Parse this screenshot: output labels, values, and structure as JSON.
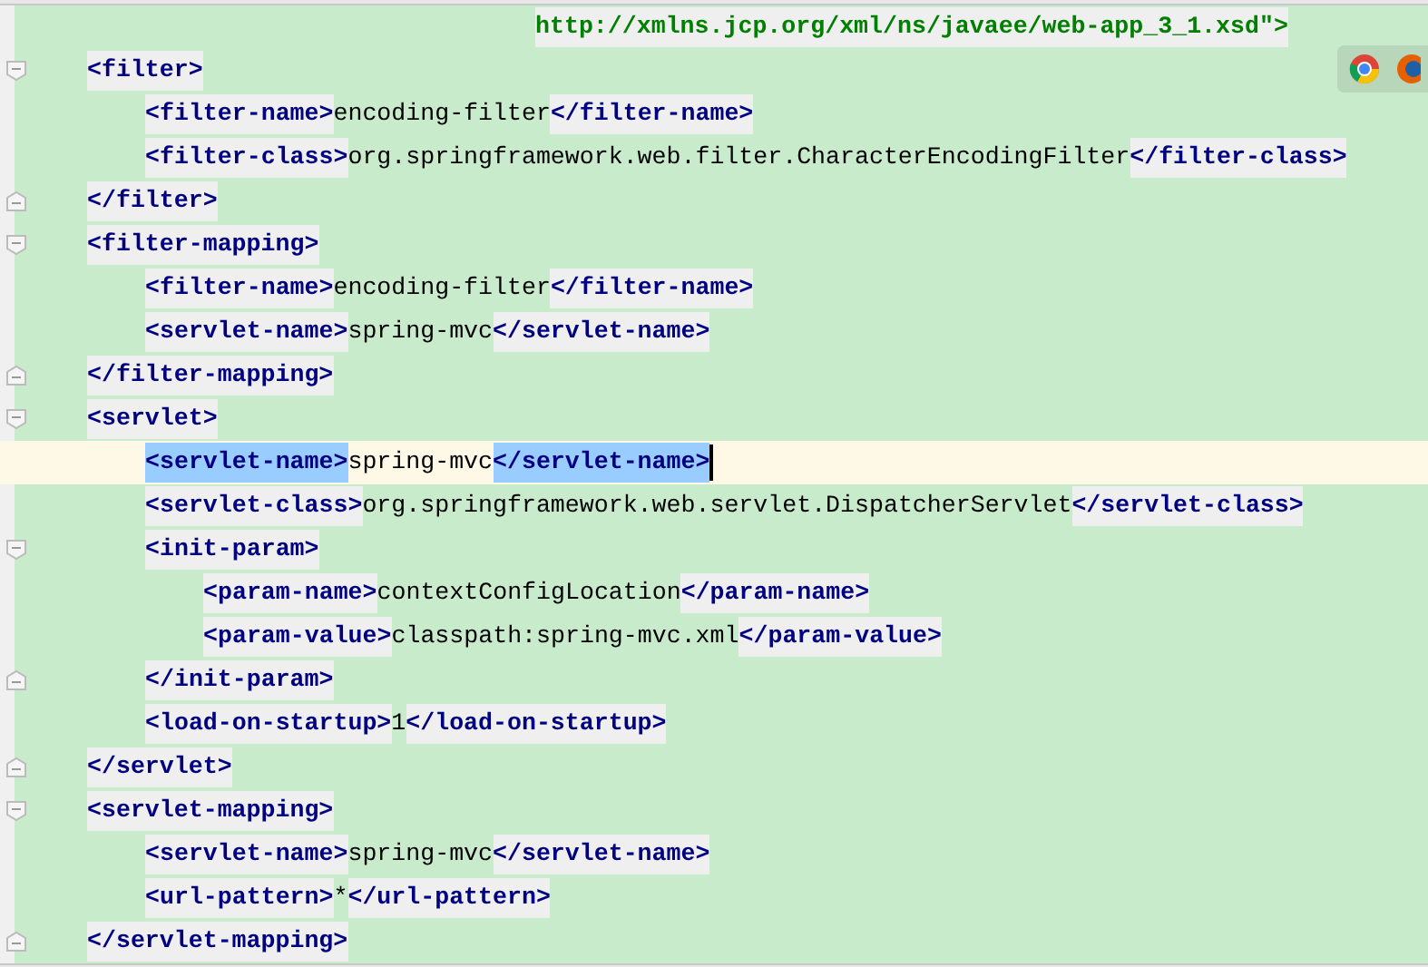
{
  "editor": {
    "lines": [
      {
        "kind": "continuation",
        "current": false,
        "tokens": [
          {
            "kind": "url",
            "text": "http://xmlns.jcp.org/xml/ns/javaee/web-app_3_1.xsd\">"
          }
        ]
      },
      {
        "kind": "open_tag",
        "current": false,
        "tokens": [
          {
            "kind": "tag",
            "text": "<filter>"
          }
        ],
        "children": [
          {
            "kind": "element",
            "current": false,
            "tokens": [
              {
                "kind": "tag",
                "text": "<filter-name>"
              },
              {
                "kind": "text",
                "text": "encoding-filter"
              },
              {
                "kind": "tag",
                "text": "</filter-name>"
              }
            ]
          },
          {
            "kind": "element",
            "current": false,
            "tokens": [
              {
                "kind": "tag",
                "text": "<filter-class>"
              },
              {
                "kind": "text",
                "text": "org.springframework.web.filter.CharacterEncodingFilter"
              },
              {
                "kind": "tag",
                "text": "</filter-class>"
              }
            ]
          }
        ]
      },
      {
        "kind": "close_tag",
        "current": false,
        "tokens": [
          {
            "kind": "tag",
            "text": "</filter>"
          }
        ]
      },
      {
        "kind": "open_tag",
        "current": false,
        "tokens": [
          {
            "kind": "tag",
            "text": "<filter-mapping>"
          }
        ],
        "children": [
          {
            "kind": "element",
            "current": false,
            "tokens": [
              {
                "kind": "tag",
                "text": "<filter-name>"
              },
              {
                "kind": "text",
                "text": "encoding-filter"
              },
              {
                "kind": "tag",
                "text": "</filter-name>"
              }
            ]
          },
          {
            "kind": "element",
            "current": false,
            "tokens": [
              {
                "kind": "tag",
                "text": "<servlet-name>"
              },
              {
                "kind": "text",
                "text": "spring-mvc"
              },
              {
                "kind": "tag",
                "text": "</servlet-name>"
              }
            ]
          }
        ]
      },
      {
        "kind": "close_tag",
        "current": false,
        "tokens": [
          {
            "kind": "tag",
            "text": "</filter-mapping>"
          }
        ]
      },
      {
        "kind": "open_tag",
        "current": false,
        "tokens": [
          {
            "kind": "tag",
            "text": "<servlet>"
          }
        ],
        "children": [
          {
            "kind": "element",
            "current": true,
            "tokens": [
              {
                "kind": "tag",
                "text": "<servlet-name>"
              },
              {
                "kind": "text",
                "text": "spring-mvc"
              },
              {
                "kind": "tag",
                "text": "</servlet-name>"
              }
            ]
          },
          {
            "kind": "element",
            "current": false,
            "tokens": [
              {
                "kind": "tag",
                "text": "<servlet-class>"
              },
              {
                "kind": "text",
                "text": "org.springframework.web.servlet.DispatcherServlet"
              },
              {
                "kind": "tag",
                "text": "</servlet-class>"
              }
            ]
          },
          {
            "kind": "open_tag",
            "current": false,
            "tokens": [
              {
                "kind": "tag",
                "text": "<init-param>"
              }
            ],
            "children": [
              {
                "kind": "element",
                "current": false,
                "tokens": [
                  {
                    "kind": "tag",
                    "text": "<param-name>"
                  },
                  {
                    "kind": "text",
                    "text": "contextConfigLocation"
                  },
                  {
                    "kind": "tag",
                    "text": "</param-name>"
                  }
                ]
              },
              {
                "kind": "element",
                "current": false,
                "tokens": [
                  {
                    "kind": "tag",
                    "text": "<param-value>"
                  },
                  {
                    "kind": "text",
                    "text": "classpath:spring-mvc.xml"
                  },
                  {
                    "kind": "tag",
                    "text": "</param-value>"
                  }
                ]
              }
            ]
          },
          {
            "kind": "close_tag",
            "current": false,
            "tokens": [
              {
                "kind": "tag",
                "text": "</init-param>"
              }
            ]
          },
          {
            "kind": "element",
            "current": false,
            "tokens": [
              {
                "kind": "tag",
                "text": "<load-on-startup>"
              },
              {
                "kind": "text",
                "text": "1"
              },
              {
                "kind": "tag",
                "text": "</load-on-startup>"
              }
            ]
          }
        ]
      },
      {
        "kind": "close_tag",
        "current": false,
        "tokens": [
          {
            "kind": "tag",
            "text": "</servlet>"
          }
        ]
      },
      {
        "kind": "open_tag",
        "current": false,
        "tokens": [
          {
            "kind": "tag",
            "text": "<servlet-mapping>"
          }
        ],
        "children": [
          {
            "kind": "element",
            "current": false,
            "tokens": [
              {
                "kind": "tag",
                "text": "<servlet-name>"
              },
              {
                "kind": "text",
                "text": "spring-mvc"
              },
              {
                "kind": "tag",
                "text": "</servlet-name>"
              }
            ]
          },
          {
            "kind": "element",
            "current": false,
            "tokens": [
              {
                "kind": "tag",
                "text": "<url-pattern>"
              },
              {
                "kind": "text",
                "text": "*"
              },
              {
                "kind": "tag",
                "text": "</url-pattern>"
              }
            ]
          }
        ]
      },
      {
        "kind": "close_tag",
        "current": false,
        "tokens": [
          {
            "kind": "tag",
            "text": "</servlet-mapping>"
          }
        ]
      }
    ]
  }
}
